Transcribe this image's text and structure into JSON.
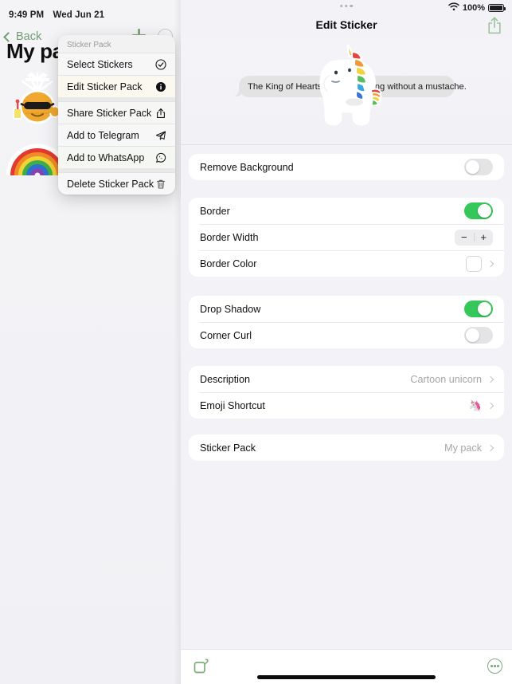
{
  "status_bar": {
    "time": "9:49 PM",
    "date": "Wed Jun 21",
    "battery_percent": "100%",
    "wifi_icon": "wifi-icon",
    "battery_icon": "battery-full-icon"
  },
  "left_panel": {
    "back_label": "Back",
    "add_icon": "plus-icon",
    "more_icon": "ellipsis-circle-icon",
    "pack_title": "My pack",
    "stickers": [
      {
        "name": "pineapple-sticker",
        "label": "Pineapple with sunglasses"
      },
      {
        "name": "rainbow-sticker",
        "label": "Rainbow"
      }
    ]
  },
  "context_menu": {
    "header": "Sticker Pack",
    "items": [
      {
        "label": "Select Stickers",
        "icon": "check-circle-icon"
      },
      {
        "label": "Edit Sticker Pack",
        "icon": "info-circle-filled-icon"
      },
      {
        "label": "Share Sticker Pack",
        "icon": "share-icon"
      },
      {
        "label": "Add to Telegram",
        "icon": "telegram-icon"
      },
      {
        "label": "Add to WhatsApp",
        "icon": "whatsapp-icon"
      },
      {
        "label": "Delete Sticker Pack",
        "icon": "trash-icon"
      }
    ]
  },
  "right_panel": {
    "title": "Edit Sticker",
    "share_icon": "share-icon",
    "multitask_icon": "multitask-dots-icon",
    "preview": {
      "bubble_text": "The King of Hearts is the only King without a mustache.",
      "sticker_name": "unicorn-sticker"
    },
    "groups": [
      {
        "name": "remove-background-group",
        "rows": [
          {
            "label": "Remove Background",
            "control": "toggle",
            "value": "off"
          }
        ]
      },
      {
        "name": "border-group",
        "rows": [
          {
            "label": "Border",
            "control": "toggle",
            "value": "on"
          },
          {
            "label": "Border Width",
            "control": "stepper",
            "minus": "−",
            "plus": "+"
          },
          {
            "label": "Border Color",
            "control": "color",
            "value": "#ffffff"
          }
        ]
      },
      {
        "name": "effects-group",
        "rows": [
          {
            "label": "Drop Shadow",
            "control": "toggle",
            "value": "on"
          },
          {
            "label": "Corner Curl",
            "control": "toggle",
            "value": "off"
          }
        ]
      },
      {
        "name": "metadata-group",
        "rows": [
          {
            "label": "Description",
            "control": "disclosure",
            "value": "Cartoon unicorn"
          },
          {
            "label": "Emoji Shortcut",
            "control": "disclosure",
            "value": "🦄"
          }
        ]
      },
      {
        "name": "pack-group",
        "rows": [
          {
            "label": "Sticker Pack",
            "control": "disclosure",
            "value": "My pack"
          }
        ]
      }
    ]
  },
  "bottom_bar": {
    "add_sticker_icon": "add-sticker-icon",
    "more_icon": "ellipsis-circle-icon"
  },
  "colors": {
    "accent_green": "#34c759",
    "tint_green": "#7eab7e",
    "background": "#f2f2f7",
    "card": "#ffffff"
  }
}
